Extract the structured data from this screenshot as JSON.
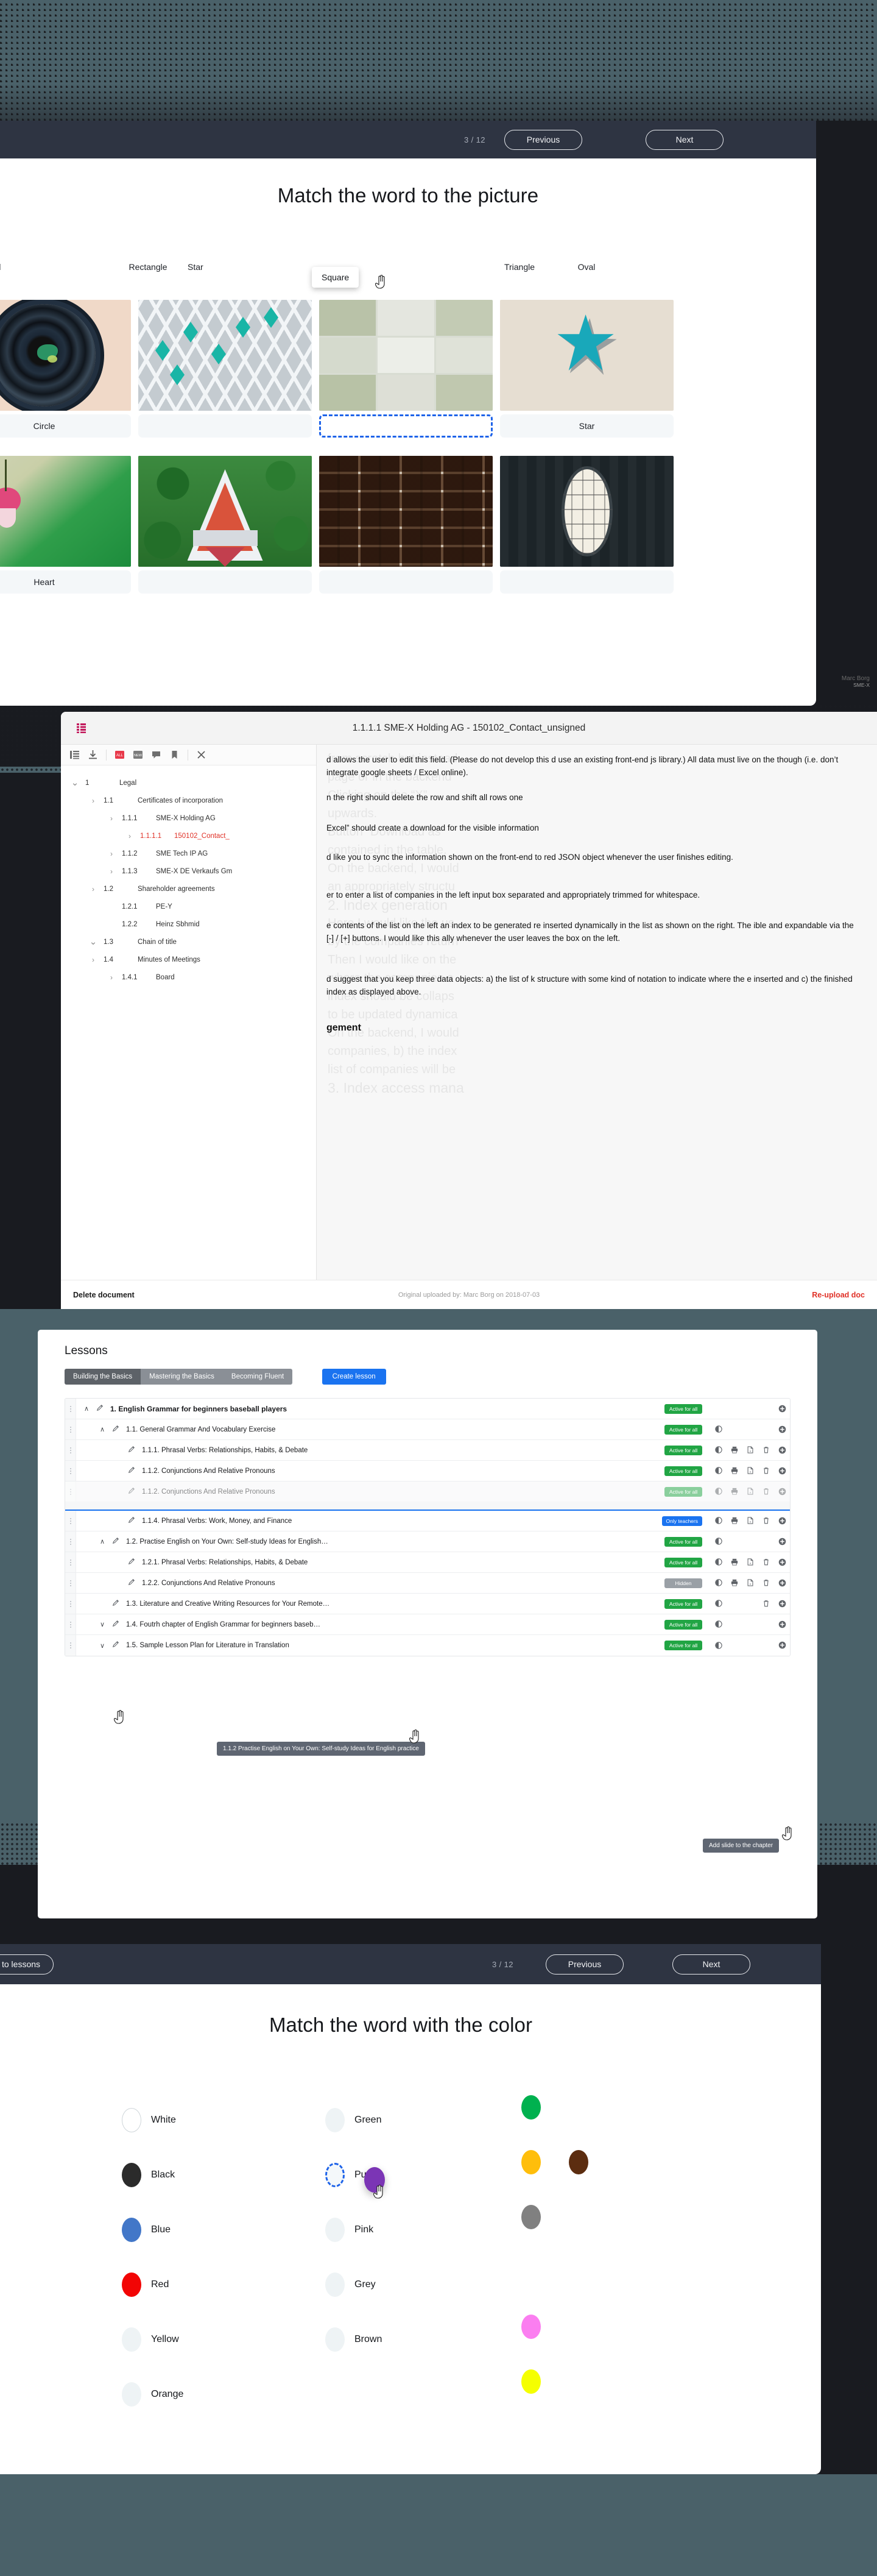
{
  "picture_slide": {
    "nav": {
      "counter": "3 / 12",
      "previous_label": "Previous",
      "next_label": "Next"
    },
    "title": "Match the word to the picture",
    "word_bank": [
      "Diamond",
      "Rectangle",
      "Star",
      "Square",
      "Triangle",
      "Oval"
    ],
    "word_bank_visible": [
      "ond",
      "Rectangle",
      "Star",
      "Triangle",
      "Oval"
    ],
    "dragging_word": "Square",
    "cells": [
      {
        "image": "camera-lens-circle",
        "answer": "Circle",
        "state": "filled"
      },
      {
        "image": "diamond-pattern-fabric",
        "answer": "",
        "state": "empty"
      },
      {
        "image": "square-tiles-green",
        "answer": "",
        "state": "drop-target-active"
      },
      {
        "image": "teal-star-ornament",
        "answer": "Star",
        "state": "filled"
      },
      {
        "image": "pink-heart-flower",
        "answer": "Heart",
        "state": "filled"
      },
      {
        "image": "triangle-aerial-building",
        "answer": "",
        "state": "empty"
      },
      {
        "image": "brick-wall-rectangles",
        "answer": "",
        "state": "empty"
      },
      {
        "image": "oval-window-dark-door",
        "answer": "",
        "state": "empty"
      }
    ]
  },
  "document_viewer": {
    "title": "1.1.1.1 SME-X Holding AG - 150102_Contact_unsigned",
    "toolbar_icons": [
      "list-view-icon",
      "download-icon",
      "all-pages-icon",
      "new-pages-icon",
      "compare-icon",
      "bookmark-icon",
      "close-icon"
    ],
    "menu_icon": "grid-menu-icon",
    "tree": [
      {
        "num": "1",
        "label": "Legal",
        "indent": 0,
        "caret": "down",
        "icon": "caret",
        "selected": false
      },
      {
        "num": "1.1",
        "label": "Certificates of incorporation",
        "indent": 1,
        "caret": "right",
        "icon": "caret",
        "selected": false
      },
      {
        "num": "1.1.1",
        "label": "SME-X Holding AG",
        "indent": 2,
        "caret": "right",
        "icon": "caret",
        "selected": false
      },
      {
        "num": "1.1.1.1",
        "label": "150102_Contact_",
        "indent": 3,
        "caret": "right",
        "icon": "caret",
        "selected": true
      },
      {
        "num": "1.1.2",
        "label": "SME Tech IP AG",
        "indent": 2,
        "caret": "right",
        "icon": "caret",
        "selected": false
      },
      {
        "num": "1.1.3",
        "label": "SME-X DE Verkaufs Gm",
        "indent": 2,
        "caret": "right",
        "icon": "caret",
        "selected": false
      },
      {
        "num": "1.2",
        "label": "Shareholder agreements",
        "indent": 1,
        "caret": "right",
        "icon": "caret",
        "selected": false
      },
      {
        "num": "1.2.1",
        "label": "PE-Y",
        "indent": 2,
        "caret": "none",
        "icon": "pdf",
        "selected": false
      },
      {
        "num": "1.2.2",
        "label": "Heinz Sbhmid",
        "indent": 2,
        "caret": "none",
        "icon": "pdf",
        "selected": false
      },
      {
        "num": "1.3",
        "label": "Chain of title",
        "indent": 1,
        "caret": "down",
        "icon": "caret",
        "selected": false
      },
      {
        "num": "1.4",
        "label": "Minutes of Meetings",
        "indent": 1,
        "caret": "right",
        "icon": "caret",
        "selected": false
      },
      {
        "num": "1.4.1",
        "label": "Board",
        "indent": 2,
        "caret": "right",
        "icon": "caret",
        "selected": false
      }
    ],
    "content_paragraphs": [
      "d allows the user to edit this field. (Please do not develop this d use an existing front-end js library.) All data must live on the though (i.e. don’t integrate google sheets / Excel online).",
      "n the right should delete the row and shift all rows one",
      "Excel” should create a download for the visible information",
      "d like you to sync the information shown on the front-end to red JSON object whenever the user finishes editing.",
      "er to enter a list of companies in the left input box separated and appropriately trimmed for whitespace.",
      "e contents of the list on the left an index to be generated re inserted dynamically in the list as shown on the right. The ible and expandable via the [-] / [+] buttons. I would like this ally whenever the user leaves the box on the left.",
      "d suggest that you keep three data objects: a) the list of k structure with some kind of notation to indicate where the e inserted and c) the finished index as displayed above.",
      "gement"
    ],
    "ghost_headings": [
      "from scratch but instead",
      "page or in the backend",
      "Clicking on the “X”",
      "upwards.",
      "Button “Download as",
      "contained in the table.",
      "On the backend, I would",
      "an appropriately structu",
      "2. Index generation",
      "Here I would like the us",
      "by the companies return",
      "Then I would like on the",
      "where the companies a",
      "index should be collaps",
      "to be updated dynamica",
      "On the backend, I would",
      "companies, b) the index",
      "list of companies will be",
      "3. Index access mana"
    ],
    "footer": {
      "delete_label": "Delete document",
      "meta": "Original uploaded by: Marc Borg on 2018-07-03",
      "reupload_label": "Re-upload doc"
    },
    "user_tag": {
      "name": "Marc Borg",
      "org": "SME-X"
    }
  },
  "lessons_panel": {
    "heading": "Lessons",
    "tabs": [
      {
        "label": "Building the Basics",
        "active": true
      },
      {
        "label": "Mastering the Basics",
        "active": false
      },
      {
        "label": "Becoming Fluent",
        "active": false
      }
    ],
    "create_label": "Create lesson",
    "tooltips": [
      {
        "text": "1.1.2 Practise English on Your Own: Self-study Ideas for English practice"
      },
      {
        "text": "Add slide to the chapter"
      }
    ],
    "rows": [
      {
        "num": "1.",
        "label": "English Grammar for beginners baseball players",
        "indent": 0,
        "caret": "up",
        "bold": true,
        "badge": "Active for all",
        "badge_color": "green",
        "icons": [
          "add"
        ],
        "state": "normal"
      },
      {
        "num": "1.1.",
        "label": "General Grammar And Vocabulary Exercise",
        "indent": 1,
        "caret": "up",
        "bold": false,
        "badge": "Active for all",
        "badge_color": "green",
        "icons": [
          "eye",
          "add"
        ],
        "state": "normal"
      },
      {
        "num": "1.1.1.",
        "label": "Phrasal Verbs: Relationships, Habits, & Debate",
        "indent": 2,
        "caret": "none",
        "bold": false,
        "badge": "Active for all",
        "badge_color": "green",
        "icons": [
          "eye",
          "print",
          "pdf",
          "trash",
          "add"
        ],
        "state": "normal"
      },
      {
        "num": "1.1.2.",
        "label": "Conjunctions And Relative Pronouns",
        "indent": 2,
        "caret": "none",
        "bold": false,
        "badge": "Active for all",
        "badge_color": "green",
        "icons": [
          "eye",
          "print",
          "pdf",
          "trash",
          "add"
        ],
        "state": "normal"
      },
      {
        "num": "1.1.2.",
        "label": "Conjunctions And Relative Pronouns",
        "indent": 2,
        "caret": "none",
        "bold": false,
        "badge": "Active for all",
        "badge_color": "green",
        "icons": [
          "eye",
          "print",
          "pdf",
          "trash",
          "add"
        ],
        "state": "dragging-ghost"
      },
      {
        "num": "1.1.4.",
        "label": "Phrasal Verbs: Work, Money, and Finance",
        "indent": 2,
        "caret": "none",
        "bold": false,
        "badge": "Only teachers",
        "badge_color": "blue",
        "icons": [
          "eye",
          "print",
          "pdf",
          "trash",
          "add"
        ],
        "state": "normal"
      },
      {
        "num": "1.2.",
        "label": "Practise English on Your Own: Self-study Ideas for English…",
        "indent": 1,
        "caret": "up",
        "bold": false,
        "badge": "Active for all",
        "badge_color": "green",
        "icons": [
          "eye",
          "add"
        ],
        "state": "normal"
      },
      {
        "num": "1.2.1.",
        "label": "Phrasal Verbs: Relationships, Habits, & Debate",
        "indent": 2,
        "caret": "none",
        "bold": false,
        "badge": "Active for all",
        "badge_color": "green",
        "icons": [
          "eye",
          "print",
          "pdf",
          "trash",
          "add"
        ],
        "state": "normal"
      },
      {
        "num": "1.2.2.",
        "label": "Conjunctions And Relative Pronouns",
        "indent": 2,
        "caret": "none",
        "bold": false,
        "badge": "Hidden",
        "badge_color": "grey",
        "icons": [
          "eye",
          "print",
          "pdf",
          "trash",
          "add"
        ],
        "state": "normal"
      },
      {
        "num": "1.3.",
        "label": "Literature and Creative Writing Resources for Your Remote…",
        "indent": 1,
        "caret": "none",
        "bold": false,
        "badge": "Active for all",
        "badge_color": "green",
        "icons": [
          "eye",
          "trash",
          "add"
        ],
        "state": "normal"
      },
      {
        "num": "1.4.",
        "label": "Foutrh chapter of English Grammar for beginners baseb…",
        "indent": 1,
        "caret": "down",
        "bold": false,
        "badge": "Active for all",
        "badge_color": "green",
        "icons": [
          "eye",
          "add"
        ],
        "state": "normal"
      },
      {
        "num": "1.5.",
        "label": "Sample Lesson Plan for Literature in Translation",
        "indent": 1,
        "caret": "down",
        "bold": false,
        "badge": "Active for all",
        "badge_color": "green",
        "icons": [
          "eye",
          "add"
        ],
        "state": "normal"
      }
    ]
  },
  "color_slide": {
    "nav": {
      "back_label": "Back to lessons",
      "counter": "3 / 12",
      "previous_label": "Previous",
      "next_label": "Next"
    },
    "title": "Match the word with the color",
    "left_column": [
      {
        "label": "White",
        "filled": true,
        "color": "#ffffff",
        "outline": true
      },
      {
        "label": "Black",
        "filled": true,
        "color": "#2b2b2b",
        "outline": false
      },
      {
        "label": "Blue",
        "filled": true,
        "color": "#4277c8",
        "outline": false
      },
      {
        "label": "Red",
        "filled": true,
        "color": "#f20505",
        "outline": false
      },
      {
        "label": "Yellow",
        "filled": false,
        "color": "#eef3f5",
        "outline": false
      },
      {
        "label": "Orange",
        "filled": false,
        "color": "#eef3f5",
        "outline": false
      }
    ],
    "right_column": [
      {
        "label": "Green",
        "filled": false,
        "color": "#eef3f5",
        "target": false
      },
      {
        "label": "Purple",
        "filled": false,
        "color": "#f4f8fa",
        "target": true
      },
      {
        "label": "Pink",
        "filled": false,
        "color": "#eef3f5",
        "target": false
      },
      {
        "label": "Grey",
        "filled": false,
        "color": "#eef3f5",
        "target": false
      },
      {
        "label": "Brown",
        "filled": false,
        "color": "#eef3f5",
        "target": false
      }
    ],
    "palette": [
      {
        "name": "green",
        "color": "#00b14f",
        "row": 0,
        "col": 0
      },
      {
        "name": "yellow",
        "color": "#ffbe0b",
        "row": 1,
        "col": 0
      },
      {
        "name": "brown",
        "color": "#5c2d10",
        "row": 1,
        "col": 1
      },
      {
        "name": "grey",
        "color": "#808080",
        "row": 2,
        "col": 0
      },
      {
        "name": "pink",
        "color": "#fb7ef0",
        "row": 4,
        "col": 0
      },
      {
        "name": "bright-yellow",
        "color": "#f5ff00",
        "row": 5,
        "col": 0
      }
    ],
    "dragging_color": {
      "name": "purple",
      "color": "#7b35b5"
    }
  },
  "theme": {
    "backdrop": "#4a6169",
    "dark_slab": "#191b20",
    "navbar": "#2e3442",
    "accent_blue": "#1a73f0",
    "drop_target_blue": "#1e63e9",
    "badge_green": "#21a544",
    "badge_grey": "#9aa0a6",
    "danger_red": "#e03127"
  }
}
